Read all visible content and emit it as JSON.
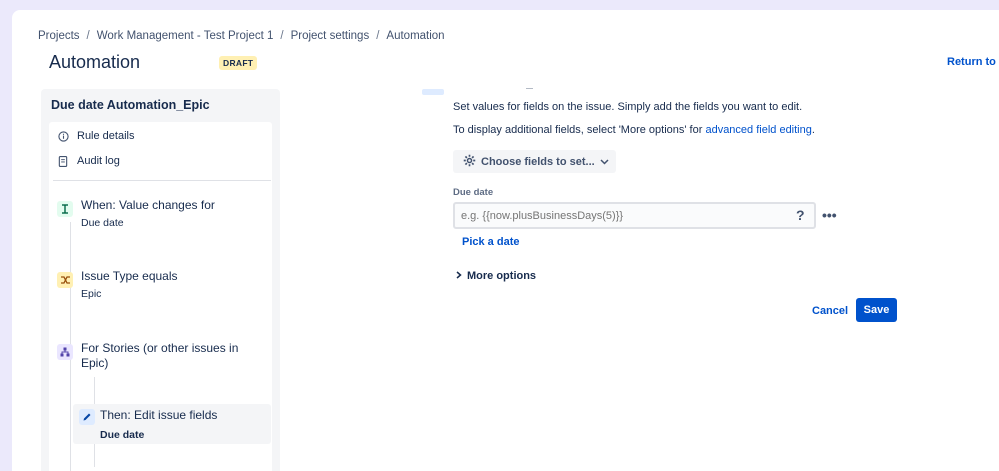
{
  "breadcrumb": {
    "items": [
      "Projects",
      "Work Management - Test Project 1",
      "Project settings",
      "Automation"
    ],
    "separator": "/"
  },
  "header": {
    "title": "Automation",
    "badge": "DRAFT",
    "return_link": "Return to li"
  },
  "sidebar": {
    "rule_name": "Due date Automation_Epic",
    "menu": [
      {
        "label": "Rule details",
        "icon": "info-icon"
      },
      {
        "label": "Audit log",
        "icon": "document-icon"
      }
    ],
    "steps": [
      {
        "title": "When: Value changes for",
        "subtitle": "Due date",
        "icon": "trigger-icon",
        "color": "#e3fcef"
      },
      {
        "title": "Issue Type equals",
        "subtitle": "Epic",
        "icon": "condition-icon",
        "color": "#fff0b3"
      },
      {
        "title": "For Stories (or other issues in Epic)",
        "subtitle": "",
        "icon": "branch-icon",
        "color": "#eae6ff"
      },
      {
        "title": "Then: Edit issue fields",
        "subtitle": "Due date",
        "icon": "edit-icon",
        "color": "#deebff"
      }
    ]
  },
  "main": {
    "description": "Set values for fields on the issue. Simply add the fields you want to edit.",
    "additional_prefix": "To display additional fields, select 'More options' for ",
    "additional_link": "advanced field editing",
    "additional_suffix": ".",
    "choose_fields_label": "Choose fields to set...",
    "due_date_label": "Due date",
    "due_date_placeholder": "e.g. {{now.plusBusinessDays(5)}}",
    "help_symbol": "?",
    "more_symbol": "•••",
    "pick_date_label": "Pick a date",
    "more_options_label": "More options",
    "cancel_label": "Cancel",
    "save_label": "Save"
  },
  "colors": {
    "accent": "#0052cc",
    "background": "#ebe9fb",
    "panel": "#f4f5f7"
  }
}
